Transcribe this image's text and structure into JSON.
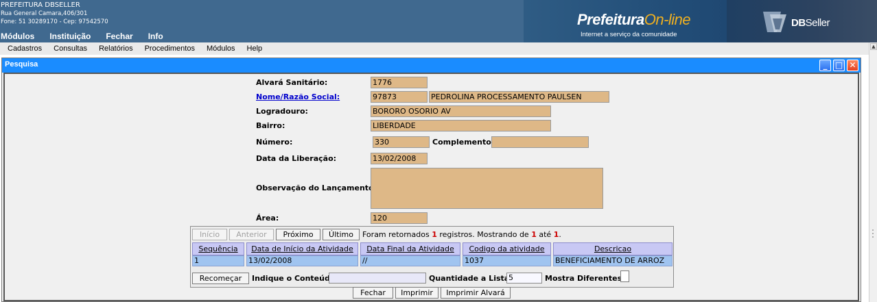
{
  "header": {
    "org_name": "PREFEITURA DBSELLER",
    "address": "Rua General Camara,406/301",
    "contact": "Fone: 51 30289170  -  Cep: 97542570",
    "brand_main": "Prefeitura",
    "brand_accent": "On-line",
    "brand_tagline": "Internet a serviço da comunidade",
    "vendor_bold": "DB",
    "vendor_rest": "Seller"
  },
  "main_menu": [
    "Módulos",
    "Instituição",
    "Fechar",
    "Info"
  ],
  "sub_menu": [
    "Cadastros",
    "Consultas",
    "Relatórios",
    "Procedimentos",
    "Módulos",
    "Help"
  ],
  "window": {
    "title": "Pesquisa"
  },
  "form": {
    "alvara_label": "Alvará Sanitário:",
    "alvara_value": "1776",
    "nome_label": "Nome/Razão Social:",
    "nome_code": "97873",
    "nome_value": "PEDROLINA PROCESSAMENTO PAULSEN",
    "logradouro_label": "Logradouro:",
    "logradouro_value": "BORORO OSORIO AV",
    "bairro_label": "Bairro:",
    "bairro_value": "LIBERDADE",
    "numero_label": "Número:",
    "numero_value": "330",
    "complemento_label": "Complemento:",
    "complemento_value": "",
    "data_label": "Data da Liberação:",
    "data_value": "13/02/2008",
    "obs_label": "Observação do Lançamento:",
    "obs_value": "",
    "area_label": "Área:",
    "area_value": "120"
  },
  "navigation": {
    "inicio": "Início",
    "anterior": "Anterior",
    "proximo": "Próximo",
    "ultimo": "Último",
    "status_prefix": "Foram retornados",
    "status_count": "1",
    "status_mid": "registros. Mostrando de",
    "status_from": "1",
    "status_ate": "até",
    "status_to": "1",
    "status_end": "."
  },
  "grid": {
    "headers": [
      "Sequência",
      "Data de Início da Atividade",
      "Data Final da Atividade",
      "Codigo da atividade",
      "Descricao"
    ],
    "rows": [
      [
        "1",
        "13/02/2008",
        "//",
        "1037",
        "BENEFICIAMENTO DE ARROZ"
      ]
    ]
  },
  "filter": {
    "recomecar": "Recomeçar",
    "conteudo_label": "Indique o Conteúdo:",
    "conteudo_value": "",
    "quantidade_label": "Quantidade a Listar:",
    "quantidade_value": "5",
    "diferentes_label": "Mostra Diferentes:"
  },
  "actions": {
    "fechar": "Fechar",
    "imprimir": "Imprimir",
    "imprimir_alvara": "Imprimir Alvará"
  },
  "colors": {
    "banner": "#40698f",
    "titlebar": "#1a8cff",
    "field_bg": "#deb887",
    "grid_header": "#c8c8f4",
    "grid_cell": "#a0c4f0"
  }
}
